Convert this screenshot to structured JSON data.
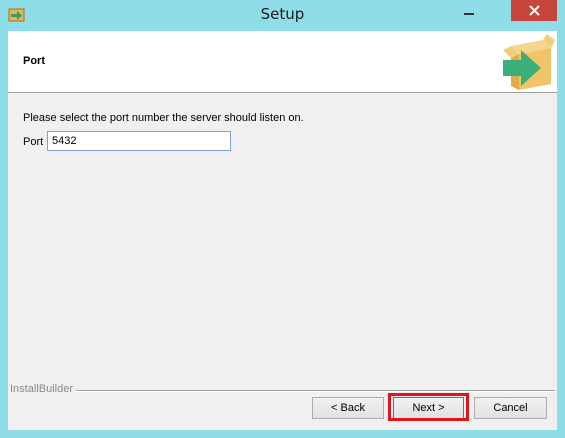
{
  "window": {
    "title": "Setup",
    "app_icon": "installer-arrow-icon",
    "controls": {
      "minimize_icon": "minimize-icon",
      "close_icon": "close-icon"
    }
  },
  "header": {
    "title": "Port",
    "logo_icon": "box-arrow-logo-icon"
  },
  "body": {
    "instruction": "Please select the port number the server should listen on.",
    "port_label": "Port",
    "port_value": "5432"
  },
  "footer": {
    "brand": "InstallBuilder",
    "back_label": "< Back",
    "next_label": "Next >",
    "cancel_label": "Cancel"
  },
  "colors": {
    "window_frame": "#8fdde8",
    "close_button": "#c7453a",
    "highlight": "#e0141b",
    "logo_box": "#f2c46a",
    "logo_arrow": "#3cae7a"
  }
}
